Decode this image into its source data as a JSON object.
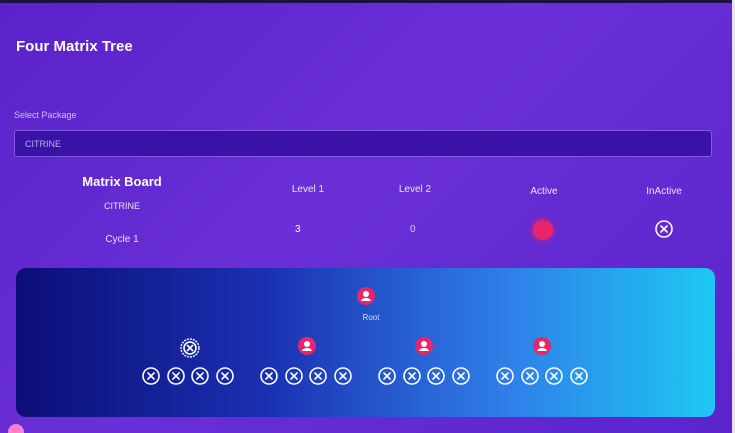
{
  "page": {
    "title": "Four Matrix Tree",
    "select_label": "Select Package",
    "select_value": "CITRINE"
  },
  "matrix_board": {
    "title": "Matrix Board",
    "package": "CITRINE",
    "cycle": "Cycle 1",
    "headers": {
      "level1": "Level 1",
      "level2": "Level 2",
      "active": "Active",
      "inactive": "InActive"
    },
    "values": {
      "level1": "3",
      "level2": "0"
    }
  },
  "tree": {
    "root_label": "Root",
    "nodes": [
      {
        "state": "inactive",
        "children": [
          "x",
          "x",
          "x",
          "x"
        ]
      },
      {
        "state": "active",
        "children": [
          "x",
          "x",
          "x",
          "x"
        ]
      },
      {
        "state": "active",
        "children": [
          "x",
          "x",
          "x",
          "x"
        ]
      },
      {
        "state": "active",
        "children": [
          "x",
          "x",
          "x",
          "x"
        ]
      }
    ]
  },
  "colors": {
    "active": "#e8256b",
    "inactive": "#ffffff"
  },
  "icons": {
    "root": "user-pin-icon",
    "active": "active-dot-icon",
    "inactive": "x-circle-icon"
  }
}
